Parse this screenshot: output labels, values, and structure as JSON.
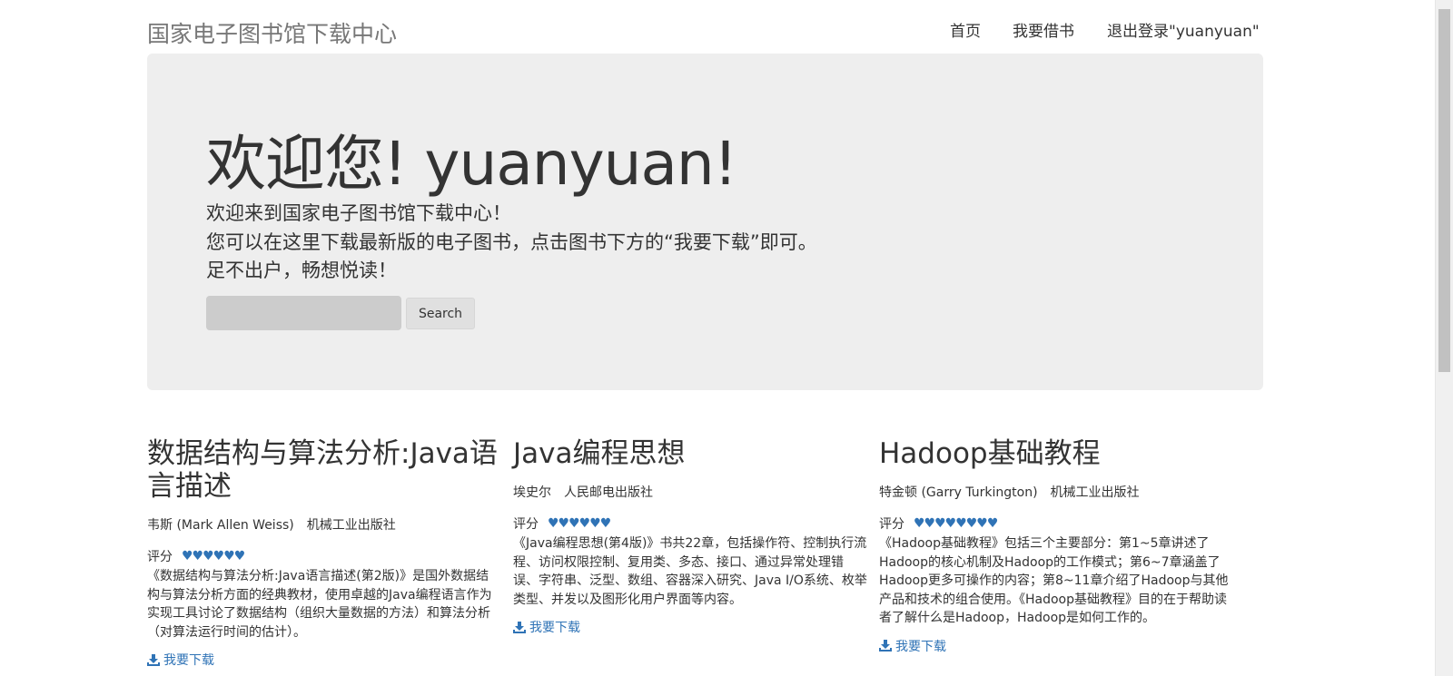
{
  "navbar": {
    "brand": "国家电子图书馆下载中心",
    "links": [
      "首页",
      "我要借书",
      "退出登录\"yuanyuan\""
    ]
  },
  "jumbotron": {
    "title": "欢迎您! yuanyuan!",
    "lines": [
      "欢迎来到国家电子图书馆下载中心！",
      "您可以在这里下载最新版的电子图书，点击图书下方的“我要下载”即可。",
      "足不出户，畅想悦读！"
    ],
    "search_placeholder": "",
    "search_button": "Search"
  },
  "books": [
    {
      "title": "数据结构与算法分析:Java语言描述",
      "author": "韦斯 (Mark Allen Weiss)",
      "publisher": "机械工业出版社",
      "rating_label": "评分",
      "rating": 6,
      "description": "《数据结构与算法分析:Java语言描述(第2版)》是国外数据结构与算法分析方面的经典教材，使用卓越的Java编程语言作为实现工具讨论了数据结构（组织大量数据的方法）和算法分析（对算法运行时间的估计）。",
      "download": "我要下载"
    },
    {
      "title": "Java编程思想",
      "author": "埃史尔",
      "publisher": "人民邮电出版社",
      "rating_label": "评分",
      "rating": 6,
      "description": "《Java编程思想(第4版)》书共22章，包括操作符、控制执行流程、访问权限控制、复用类、多态、接口、通过异常处理错误、字符串、泛型、数组、容器深入研究、Java I/O系统、枚举类型、并发以及图形化用户界面等内容。",
      "download": "我要下载"
    },
    {
      "title": "Hadoop基础教程",
      "author": "特金顿 (Garry Turkington)",
      "publisher": "机械工业出版社",
      "rating_label": "评分",
      "rating": 8,
      "description": "《Hadoop基础教程》包括三个主要部分：第1~5章讲述了Hadoop的核心机制及Hadoop的工作模式；第6~7章涵盖了Hadoop更多可操作的内容；第8~11章介绍了Hadoop与其他产品和技术的组合使用。《Hadoop基础教程》目的在于帮助读者了解什么是Hadoop，Hadoop是如何工作的。",
      "download": "我要下载"
    }
  ],
  "colors": {
    "link": "#2f73b6",
    "jumbotron_bg": "#eeeeee",
    "brand": "#777777"
  }
}
